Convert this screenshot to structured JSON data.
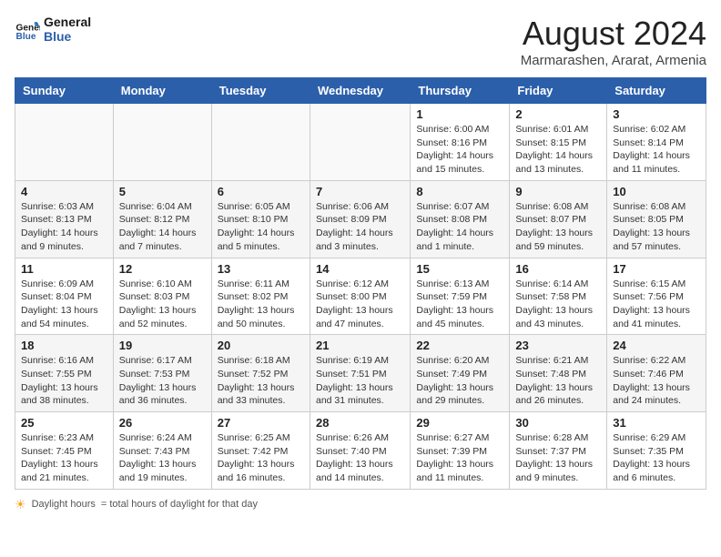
{
  "logo": {
    "line1": "General",
    "line2": "Blue"
  },
  "title": "August 2024",
  "location": "Marmarashen, Ararat, Armenia",
  "weekdays": [
    "Sunday",
    "Monday",
    "Tuesday",
    "Wednesday",
    "Thursday",
    "Friday",
    "Saturday"
  ],
  "weeks": [
    [
      {
        "day": "",
        "info": ""
      },
      {
        "day": "",
        "info": ""
      },
      {
        "day": "",
        "info": ""
      },
      {
        "day": "",
        "info": ""
      },
      {
        "day": "1",
        "info": "Sunrise: 6:00 AM\nSunset: 8:16 PM\nDaylight: 14 hours and 15 minutes."
      },
      {
        "day": "2",
        "info": "Sunrise: 6:01 AM\nSunset: 8:15 PM\nDaylight: 14 hours and 13 minutes."
      },
      {
        "day": "3",
        "info": "Sunrise: 6:02 AM\nSunset: 8:14 PM\nDaylight: 14 hours and 11 minutes."
      }
    ],
    [
      {
        "day": "4",
        "info": "Sunrise: 6:03 AM\nSunset: 8:13 PM\nDaylight: 14 hours and 9 minutes."
      },
      {
        "day": "5",
        "info": "Sunrise: 6:04 AM\nSunset: 8:12 PM\nDaylight: 14 hours and 7 minutes."
      },
      {
        "day": "6",
        "info": "Sunrise: 6:05 AM\nSunset: 8:10 PM\nDaylight: 14 hours and 5 minutes."
      },
      {
        "day": "7",
        "info": "Sunrise: 6:06 AM\nSunset: 8:09 PM\nDaylight: 14 hours and 3 minutes."
      },
      {
        "day": "8",
        "info": "Sunrise: 6:07 AM\nSunset: 8:08 PM\nDaylight: 14 hours and 1 minute."
      },
      {
        "day": "9",
        "info": "Sunrise: 6:08 AM\nSunset: 8:07 PM\nDaylight: 13 hours and 59 minutes."
      },
      {
        "day": "10",
        "info": "Sunrise: 6:08 AM\nSunset: 8:05 PM\nDaylight: 13 hours and 57 minutes."
      }
    ],
    [
      {
        "day": "11",
        "info": "Sunrise: 6:09 AM\nSunset: 8:04 PM\nDaylight: 13 hours and 54 minutes."
      },
      {
        "day": "12",
        "info": "Sunrise: 6:10 AM\nSunset: 8:03 PM\nDaylight: 13 hours and 52 minutes."
      },
      {
        "day": "13",
        "info": "Sunrise: 6:11 AM\nSunset: 8:02 PM\nDaylight: 13 hours and 50 minutes."
      },
      {
        "day": "14",
        "info": "Sunrise: 6:12 AM\nSunset: 8:00 PM\nDaylight: 13 hours and 47 minutes."
      },
      {
        "day": "15",
        "info": "Sunrise: 6:13 AM\nSunset: 7:59 PM\nDaylight: 13 hours and 45 minutes."
      },
      {
        "day": "16",
        "info": "Sunrise: 6:14 AM\nSunset: 7:58 PM\nDaylight: 13 hours and 43 minutes."
      },
      {
        "day": "17",
        "info": "Sunrise: 6:15 AM\nSunset: 7:56 PM\nDaylight: 13 hours and 41 minutes."
      }
    ],
    [
      {
        "day": "18",
        "info": "Sunrise: 6:16 AM\nSunset: 7:55 PM\nDaylight: 13 hours and 38 minutes."
      },
      {
        "day": "19",
        "info": "Sunrise: 6:17 AM\nSunset: 7:53 PM\nDaylight: 13 hours and 36 minutes."
      },
      {
        "day": "20",
        "info": "Sunrise: 6:18 AM\nSunset: 7:52 PM\nDaylight: 13 hours and 33 minutes."
      },
      {
        "day": "21",
        "info": "Sunrise: 6:19 AM\nSunset: 7:51 PM\nDaylight: 13 hours and 31 minutes."
      },
      {
        "day": "22",
        "info": "Sunrise: 6:20 AM\nSunset: 7:49 PM\nDaylight: 13 hours and 29 minutes."
      },
      {
        "day": "23",
        "info": "Sunrise: 6:21 AM\nSunset: 7:48 PM\nDaylight: 13 hours and 26 minutes."
      },
      {
        "day": "24",
        "info": "Sunrise: 6:22 AM\nSunset: 7:46 PM\nDaylight: 13 hours and 24 minutes."
      }
    ],
    [
      {
        "day": "25",
        "info": "Sunrise: 6:23 AM\nSunset: 7:45 PM\nDaylight: 13 hours and 21 minutes."
      },
      {
        "day": "26",
        "info": "Sunrise: 6:24 AM\nSunset: 7:43 PM\nDaylight: 13 hours and 19 minutes."
      },
      {
        "day": "27",
        "info": "Sunrise: 6:25 AM\nSunset: 7:42 PM\nDaylight: 13 hours and 16 minutes."
      },
      {
        "day": "28",
        "info": "Sunrise: 6:26 AM\nSunset: 7:40 PM\nDaylight: 13 hours and 14 minutes."
      },
      {
        "day": "29",
        "info": "Sunrise: 6:27 AM\nSunset: 7:39 PM\nDaylight: 13 hours and 11 minutes."
      },
      {
        "day": "30",
        "info": "Sunrise: 6:28 AM\nSunset: 7:37 PM\nDaylight: 13 hours and 9 minutes."
      },
      {
        "day": "31",
        "info": "Sunrise: 6:29 AM\nSunset: 7:35 PM\nDaylight: 13 hours and 6 minutes."
      }
    ]
  ],
  "footer": {
    "daylight_label": "Daylight hours"
  }
}
